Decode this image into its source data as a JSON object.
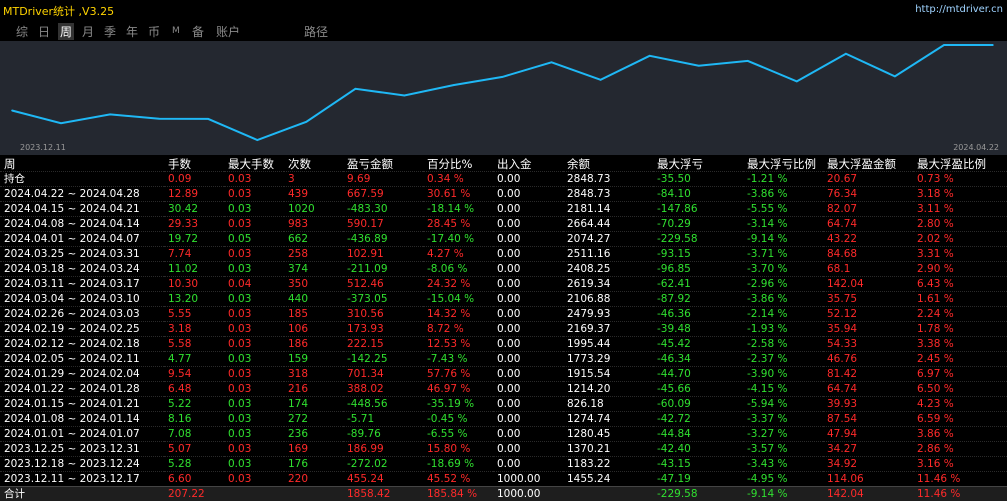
{
  "title": "MTDriver统计 ,V3.25",
  "site": "http://mtdriver.cn",
  "tabs": [
    {
      "label": "综",
      "active": false
    },
    {
      "label": "日",
      "active": false
    },
    {
      "label": "周",
      "active": true
    },
    {
      "label": "月",
      "active": false
    },
    {
      "label": "季",
      "active": false
    },
    {
      "label": "年",
      "active": false
    },
    {
      "label": "币",
      "active": false
    },
    {
      "label": "M",
      "active": false,
      "small": true
    },
    {
      "label": "备",
      "active": false
    },
    {
      "label": "账户",
      "active": false
    },
    {
      "label": "路径",
      "active": false
    }
  ],
  "colors": {
    "chart_bg": "#242830",
    "line": "#1fb8f5",
    "profit": "#ff2a2a",
    "loss": "#30e030"
  },
  "chart_data": {
    "type": "line",
    "x_start_label": "2023.12.11",
    "x_end_label": "2024.04.22",
    "values": [
      1455.24,
      1183.22,
      1370.21,
      1280.45,
      1274.74,
      826.18,
      1214.2,
      1915.54,
      1773.29,
      1995.44,
      2169.37,
      2479.93,
      2106.88,
      2619.34,
      2408.25,
      2511.16,
      2074.27,
      2664.44,
      2181.14,
      2848.73,
      2848.73
    ],
    "ylim": [
      826.18,
      2848.73
    ]
  },
  "table": {
    "headers": [
      "周",
      "手数",
      "最大手数",
      "次数",
      "盈亏金额",
      "百分比%",
      "出入金",
      "余额",
      "最大浮亏",
      "最大浮亏比例",
      "最大浮盈金额",
      "最大浮盈比例"
    ],
    "rows": [
      {
        "sign": "pos",
        "cells": [
          "持仓",
          "0.09",
          "0.03",
          "3",
          "9.69",
          "0.34 %",
          "0.00",
          "2848.73",
          "-35.50",
          "-1.21 %",
          "20.67",
          "0.73 %"
        ]
      },
      {
        "sign": "pos",
        "cells": [
          "2024.04.22 ~ 2024.04.28",
          "12.89",
          "0.03",
          "439",
          "667.59",
          "30.61 %",
          "0.00",
          "2848.73",
          "-84.10",
          "-3.86 %",
          "76.34",
          "3.18 %"
        ]
      },
      {
        "sign": "neg",
        "cells": [
          "2024.04.15 ~ 2024.04.21",
          "30.42",
          "0.03",
          "1020",
          "-483.30",
          "-18.14 %",
          "0.00",
          "2181.14",
          "-147.86",
          "-5.55 %",
          "82.07",
          "3.11 %"
        ]
      },
      {
        "sign": "pos",
        "cells": [
          "2024.04.08 ~ 2024.04.14",
          "29.33",
          "0.03",
          "983",
          "590.17",
          "28.45 %",
          "0.00",
          "2664.44",
          "-70.29",
          "-3.14 %",
          "64.74",
          "2.80 %"
        ]
      },
      {
        "sign": "neg",
        "cells": [
          "2024.04.01 ~ 2024.04.07",
          "19.72",
          "0.05",
          "662",
          "-436.89",
          "-17.40 %",
          "0.00",
          "2074.27",
          "-229.58",
          "-9.14 %",
          "43.22",
          "2.02 %"
        ]
      },
      {
        "sign": "pos",
        "cells": [
          "2024.03.25 ~ 2024.03.31",
          "7.74",
          "0.03",
          "258",
          "102.91",
          "4.27 %",
          "0.00",
          "2511.16",
          "-93.15",
          "-3.71 %",
          "84.68",
          "3.31 %"
        ]
      },
      {
        "sign": "neg",
        "cells": [
          "2024.03.18 ~ 2024.03.24",
          "11.02",
          "0.03",
          "374",
          "-211.09",
          "-8.06 %",
          "0.00",
          "2408.25",
          "-96.85",
          "-3.70 %",
          "68.1",
          "2.90 %"
        ]
      },
      {
        "sign": "pos",
        "cells": [
          "2024.03.11 ~ 2024.03.17",
          "10.30",
          "0.04",
          "350",
          "512.46",
          "24.32 %",
          "0.00",
          "2619.34",
          "-62.41",
          "-2.96 %",
          "142.04",
          "6.43 %"
        ]
      },
      {
        "sign": "neg",
        "cells": [
          "2024.03.04 ~ 2024.03.10",
          "13.20",
          "0.03",
          "440",
          "-373.05",
          "-15.04 %",
          "0.00",
          "2106.88",
          "-87.92",
          "-3.86 %",
          "35.75",
          "1.61 %"
        ]
      },
      {
        "sign": "pos",
        "cells": [
          "2024.02.26 ~ 2024.03.03",
          "5.55",
          "0.03",
          "185",
          "310.56",
          "14.32 %",
          "0.00",
          "2479.93",
          "-46.36",
          "-2.14 %",
          "52.12",
          "2.24 %"
        ]
      },
      {
        "sign": "pos",
        "cells": [
          "2024.02.19 ~ 2024.02.25",
          "3.18",
          "0.03",
          "106",
          "173.93",
          "8.72 %",
          "0.00",
          "2169.37",
          "-39.48",
          "-1.93 %",
          "35.94",
          "1.78 %"
        ]
      },
      {
        "sign": "pos",
        "cells": [
          "2024.02.12 ~ 2024.02.18",
          "5.58",
          "0.03",
          "186",
          "222.15",
          "12.53 %",
          "0.00",
          "1995.44",
          "-45.42",
          "-2.58 %",
          "54.33",
          "3.38 %"
        ]
      },
      {
        "sign": "neg",
        "cells": [
          "2024.02.05 ~ 2024.02.11",
          "4.77",
          "0.03",
          "159",
          "-142.25",
          "-7.43 %",
          "0.00",
          "1773.29",
          "-46.34",
          "-2.37 %",
          "46.76",
          "2.45 %"
        ]
      },
      {
        "sign": "pos",
        "cells": [
          "2024.01.29 ~ 2024.02.04",
          "9.54",
          "0.03",
          "318",
          "701.34",
          "57.76 %",
          "0.00",
          "1915.54",
          "-44.70",
          "-3.90 %",
          "81.42",
          "6.97 %"
        ]
      },
      {
        "sign": "pos",
        "cells": [
          "2024.01.22 ~ 2024.01.28",
          "6.48",
          "0.03",
          "216",
          "388.02",
          "46.97 %",
          "0.00",
          "1214.20",
          "-45.66",
          "-4.15 %",
          "64.74",
          "6.50 %"
        ]
      },
      {
        "sign": "neg",
        "cells": [
          "2024.01.15 ~ 2024.01.21",
          "5.22",
          "0.03",
          "174",
          "-448.56",
          "-35.19 %",
          "0.00",
          "826.18",
          "-60.09",
          "-5.94 %",
          "39.93",
          "4.23 %"
        ]
      },
      {
        "sign": "neg",
        "cells": [
          "2024.01.08 ~ 2024.01.14",
          "8.16",
          "0.03",
          "272",
          "-5.71",
          "-0.45 %",
          "0.00",
          "1274.74",
          "-42.72",
          "-3.37 %",
          "87.54",
          "6.59 %"
        ]
      },
      {
        "sign": "neg",
        "cells": [
          "2024.01.01 ~ 2024.01.07",
          "7.08",
          "0.03",
          "236",
          "-89.76",
          "-6.55 %",
          "0.00",
          "1280.45",
          "-44.84",
          "-3.27 %",
          "47.94",
          "3.86 %"
        ]
      },
      {
        "sign": "pos",
        "cells": [
          "2023.12.25 ~ 2023.12.31",
          "5.07",
          "0.03",
          "169",
          "186.99",
          "15.80 %",
          "0.00",
          "1370.21",
          "-42.40",
          "-3.57 %",
          "34.27",
          "2.86 %"
        ]
      },
      {
        "sign": "neg",
        "cells": [
          "2023.12.18 ~ 2023.12.24",
          "5.28",
          "0.03",
          "176",
          "-272.02",
          "-18.69 %",
          "0.00",
          "1183.22",
          "-43.15",
          "-3.43 %",
          "34.92",
          "3.16 %"
        ]
      },
      {
        "sign": "pos",
        "cells": [
          "2023.12.11 ~ 2023.12.17",
          "6.60",
          "0.03",
          "220",
          "455.24",
          "45.52 %",
          "1000.00",
          "1455.24",
          "-47.19",
          "-4.95 %",
          "114.06",
          "11.46 %"
        ]
      }
    ],
    "total": {
      "cells": [
        "合计",
        "207.22",
        "",
        "",
        "1858.42",
        "185.84 %",
        "1000.00",
        "",
        "-229.58",
        "-9.14 %",
        "142.04",
        "11.46 %"
      ]
    }
  }
}
